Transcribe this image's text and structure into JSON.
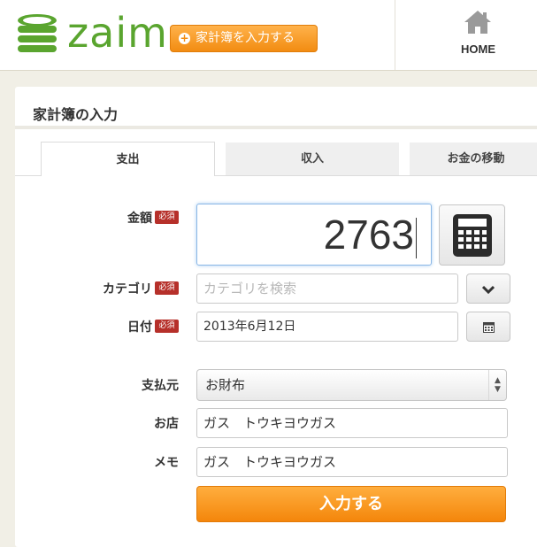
{
  "brand": {
    "name": "zaim",
    "color": "#5aa52f"
  },
  "header": {
    "add_button_label": "家計簿を入力する",
    "home_label": "HOME"
  },
  "panel": {
    "title": "家計簿の入力",
    "tabs": [
      {
        "label": "支出",
        "active": true
      },
      {
        "label": "収入",
        "active": false
      },
      {
        "label": "お金の移動",
        "active": false
      }
    ]
  },
  "form": {
    "required_badge": "必須",
    "amount": {
      "label": "金額",
      "value": "2763"
    },
    "category": {
      "label": "カテゴリ",
      "placeholder": "カテゴリを検索"
    },
    "date": {
      "label": "日付",
      "value": "2013年6月12日"
    },
    "payment_source": {
      "label": "支払元",
      "selected": "お財布"
    },
    "shop": {
      "label": "お店",
      "value": "ガス　トウキヨウガス"
    },
    "memo": {
      "label": "メモ",
      "value": "ガス　トウキヨウガス"
    },
    "submit_label": "入力する"
  },
  "colors": {
    "accent_orange": "#f4860b",
    "required_red": "#b6302a",
    "focus_blue": "#8ab7e6"
  },
  "icons": [
    "coins-logo-icon",
    "plus-circle-icon",
    "home-icon",
    "calculator-icon",
    "chevron-down-icon",
    "calendar-icon",
    "select-arrows-icon"
  ]
}
